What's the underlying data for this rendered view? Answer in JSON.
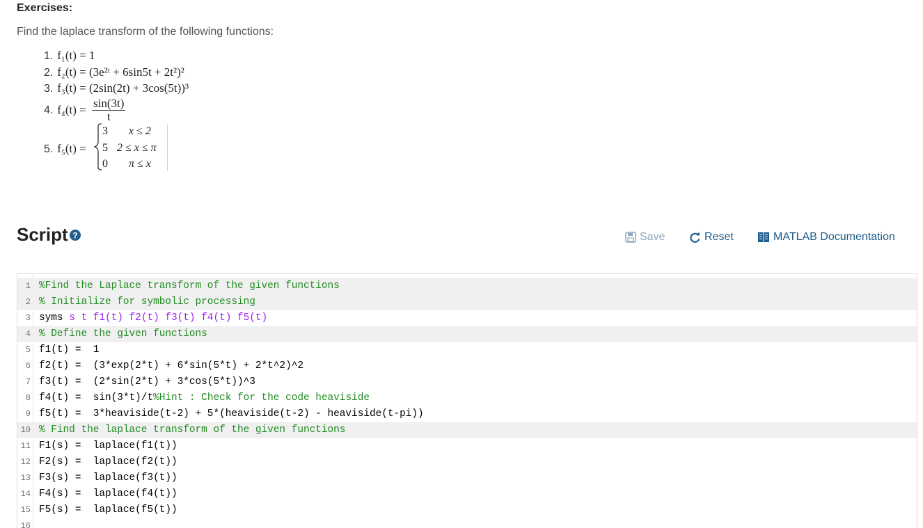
{
  "exercises": {
    "title": "Exercises:",
    "prompt": "Find the laplace transform of the following functions:",
    "items": [
      {
        "num": "1.",
        "expr": "f₁(t) = 1"
      },
      {
        "num": "2.",
        "expr": "f₂(t) = (3e²ᵗ + 6sin5t + 2t²)²"
      },
      {
        "num": "3.",
        "expr": "f₃(t) = (2sin(2t) + 3cos(5t))³"
      },
      {
        "num": "4.",
        "lhs": "f₄(t) =",
        "numerator": "sin(3t)",
        "denominator": "t"
      },
      {
        "num": "5.",
        "lhs": "f₅(t) =",
        "cases": [
          {
            "value": "3",
            "cond": "x ≤ 2"
          },
          {
            "value": "5",
            "cond": "2 ≤ x ≤ π"
          },
          {
            "value": "0",
            "cond": "π ≤ x"
          }
        ]
      }
    ]
  },
  "script": {
    "title": "Script",
    "help_icon": "question-circle-icon",
    "toolbar": {
      "save_label": "Save",
      "reset_label": "Reset",
      "doc_label": "MATLAB Documentation"
    },
    "colors": {
      "comment": "#228b22",
      "keyword_arg": "#a020f0",
      "link": "#1f5d8c",
      "disabled": "#8fa7c0"
    },
    "lines": [
      {
        "n": "1",
        "text": "%Find the Laplace transform of the given functions"
      },
      {
        "n": "2",
        "text": "% Initialize for symbolic processing"
      },
      {
        "n": "3",
        "prefix": "syms ",
        "args": "s t f1(t) f2(t) f3(t) f4(t) f5(t)"
      },
      {
        "n": "4",
        "text": "% Define the given functions"
      },
      {
        "n": "5",
        "text": "f1(t) =  1"
      },
      {
        "n": "6",
        "text": "f2(t) =  (3*exp(2*t) + 6*sin(5*t) + 2*t^2)^2"
      },
      {
        "n": "7",
        "text": "f3(t) =  (2*sin(2*t) + 3*cos(5*t))^3"
      },
      {
        "n": "8",
        "prefix": "f4(t) =  sin(3*t)/t",
        "comment": "%Hint : Check for the code heaviside"
      },
      {
        "n": "9",
        "text": "f5(t) =  3*heaviside(t-2) + 5*(heaviside(t-2) - heaviside(t-pi))"
      },
      {
        "n": "10",
        "text": "% Find the laplace transform of the given functions"
      },
      {
        "n": "11",
        "text": "F1(s) =  laplace(f1(t))"
      },
      {
        "n": "12",
        "text": "F2(s) =  laplace(f2(t))"
      },
      {
        "n": "13",
        "text": "F3(s) =  laplace(f3(t))"
      },
      {
        "n": "14",
        "text": "F4(s) =  laplace(f4(t))"
      },
      {
        "n": "15",
        "text": "F5(s) =  laplace(f5(t))"
      },
      {
        "n": "16",
        "text": ""
      }
    ]
  }
}
